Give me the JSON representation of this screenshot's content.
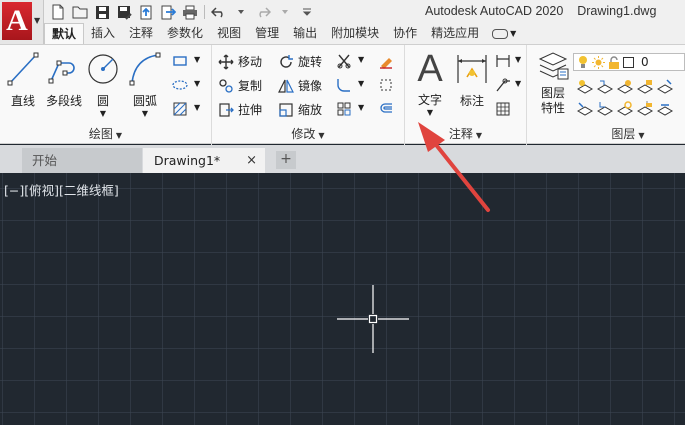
{
  "app": {
    "title": "Autodesk AutoCAD 2020",
    "document": "Drawing1.dwg",
    "logo_letter": "A"
  },
  "ribbon_tabs": [
    "默认",
    "插入",
    "注释",
    "参数化",
    "视图",
    "管理",
    "输出",
    "附加模块",
    "协作",
    "精选应用"
  ],
  "draw_panel": {
    "line": "直线",
    "polyline": "多段线",
    "circle": "圆",
    "arc": "圆弧",
    "label": "绘图"
  },
  "modify_panel": {
    "move": "移动",
    "rotate": "旋转",
    "copy": "复制",
    "mirror": "镜像",
    "stretch": "拉伸",
    "scale": "缩放",
    "label": "修改"
  },
  "annotation_panel": {
    "text_glyph": "A",
    "text": "文字",
    "dimension": "标注",
    "label": "注释"
  },
  "layers_panel": {
    "layer_properties_1": "图层",
    "layer_properties_2": "特性",
    "current_layer": "0",
    "label": "图层"
  },
  "file_tabs": {
    "start": "开始",
    "active": "Drawing1*",
    "close": "×",
    "add": "+"
  },
  "viewport": {
    "label": "[−][俯视][二维线框]"
  },
  "colors": {
    "canvas": "#212830",
    "annotation_arrow": "#e0443e",
    "accent_red": "#c81e25"
  }
}
